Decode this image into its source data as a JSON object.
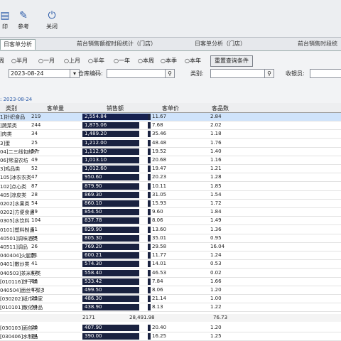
{
  "toolbar": {
    "items": [
      {
        "label": "印",
        "icon": "print-icon"
      },
      {
        "label": "参考",
        "icon": "edit-icon"
      },
      {
        "label": "关闭",
        "icon": "power-icon"
      }
    ]
  },
  "tabs": [
    {
      "label": "日客单分析"
    },
    {
      "label": "前台销售额按时段统计（门店）"
    },
    {
      "label": "日客单分析（门店）"
    },
    {
      "label": "前台销售时段统"
    }
  ],
  "filters": {
    "period_options": [
      "周",
      "半月",
      "一月",
      "上月",
      "半年",
      "一年",
      "本周",
      "本季",
      "本年"
    ],
    "date_value": "2023-08-24",
    "store_code_label": "仓库编码:",
    "category_label": "类别:",
    "cashier_label": "收银员:",
    "reset_label": "重置查询条件"
  },
  "date_caption": ": 2023-08-24",
  "table": {
    "columns": [
      "类别",
      "客单量",
      "销售额",
      "客单价",
      "客品数"
    ],
    "rows": [
      {
        "name": "1]针织食品",
        "count": "219",
        "sales": "2,554.84",
        "price": "11.67",
        "items": "2.84"
      },
      {
        "name": "]蔬菜类",
        "count": "244",
        "sales": "1,875.06",
        "price": "7.68",
        "items": "2.02"
      },
      {
        "name": "]肉类",
        "count": "34",
        "sales": "1,489.20",
        "price": "35.46",
        "items": "1.18"
      },
      {
        "name": "3]蛋",
        "count": "25",
        "sales": "1,212.00",
        "price": "48.48",
        "items": "1.76"
      },
      {
        "name": "04]二三线包邮ST",
        "count": "57",
        "sales": "1,112.90",
        "price": "19.52",
        "items": "1.40"
      },
      {
        "name": "06]常温农坊",
        "count": "49",
        "sales": "1,013.10",
        "price": "20.68",
        "items": "1.16"
      },
      {
        "name": "3]鸡品类",
        "count": "52",
        "sales": "1,012.60",
        "price": "19.47",
        "items": "1.21"
      },
      {
        "name": "105]冰农农类",
        "count": "47",
        "sales": "950.60",
        "price": "20.23",
        "items": "1.28"
      },
      {
        "name": "102]点心类",
        "count": "87",
        "sales": "879.90",
        "price": "10.11",
        "items": "1.85"
      },
      {
        "name": "405]凉皮类",
        "count": "28",
        "sales": "869.30",
        "price": "31.05",
        "items": "1.54"
      },
      {
        "name": "0202]水果类",
        "count": "54",
        "sales": "860.10",
        "price": "15.93",
        "items": "1.72"
      },
      {
        "name": "0202]方便食品",
        "count": "89",
        "sales": "854.50",
        "price": "9.60",
        "items": "1.84"
      },
      {
        "name": "0305]水饮料",
        "count": "104",
        "sales": "837.78",
        "price": "8.06",
        "items": "1.49"
      },
      {
        "name": "0101]塑料制品",
        "count": "61",
        "sales": "829.90",
        "price": "13.60",
        "items": "1.36"
      },
      {
        "name": "40501]调味酒类",
        "count": "23",
        "sales": "805.30",
        "price": "35.01",
        "items": "0.95"
      },
      {
        "name": "40511]调品",
        "count": "26",
        "sales": "769.20",
        "price": "29.58",
        "items": "16.04"
      },
      {
        "name": "040404]火腿肠",
        "count": "51",
        "sales": "600.21",
        "price": "11.77",
        "items": "1.24"
      },
      {
        "name": "0401]散炒类",
        "count": "41",
        "sales": "574.30",
        "price": "14.01",
        "items": "0.53"
      },
      {
        "name": "040503]茶米粉类",
        "count": "12",
        "sales": "558.40",
        "price": "46.53",
        "items": "0.02"
      },
      {
        "name": "[010116]饼干类",
        "count": "68",
        "sales": "533.42",
        "price": "7.84",
        "items": "1.66"
      },
      {
        "name": "040504]面丝干菜类",
        "count": "62",
        "sales": "499.50",
        "price": "8.06",
        "items": "1.20"
      },
      {
        "name": "[030202]纸巾类家",
        "count": "23",
        "sales": "486.30",
        "price": "21.14",
        "items": "1.00"
      },
      {
        "name": "[010101]散化食品",
        "count": "54",
        "sales": "438.90",
        "price": "8.13",
        "items": "1.22"
      }
    ],
    "total": {
      "count": "2171",
      "sales": "28,491.98",
      "items": "76.73"
    },
    "extra_rows": [
      {
        "name": "[030103]面包类",
        "count": "20",
        "sales": "407.90",
        "price": "20.40",
        "items": "1.20"
      },
      {
        "name": "[030406]水制品",
        "count": "24",
        "sales": "390.00",
        "price": "16.25",
        "items": "1.25"
      }
    ]
  }
}
